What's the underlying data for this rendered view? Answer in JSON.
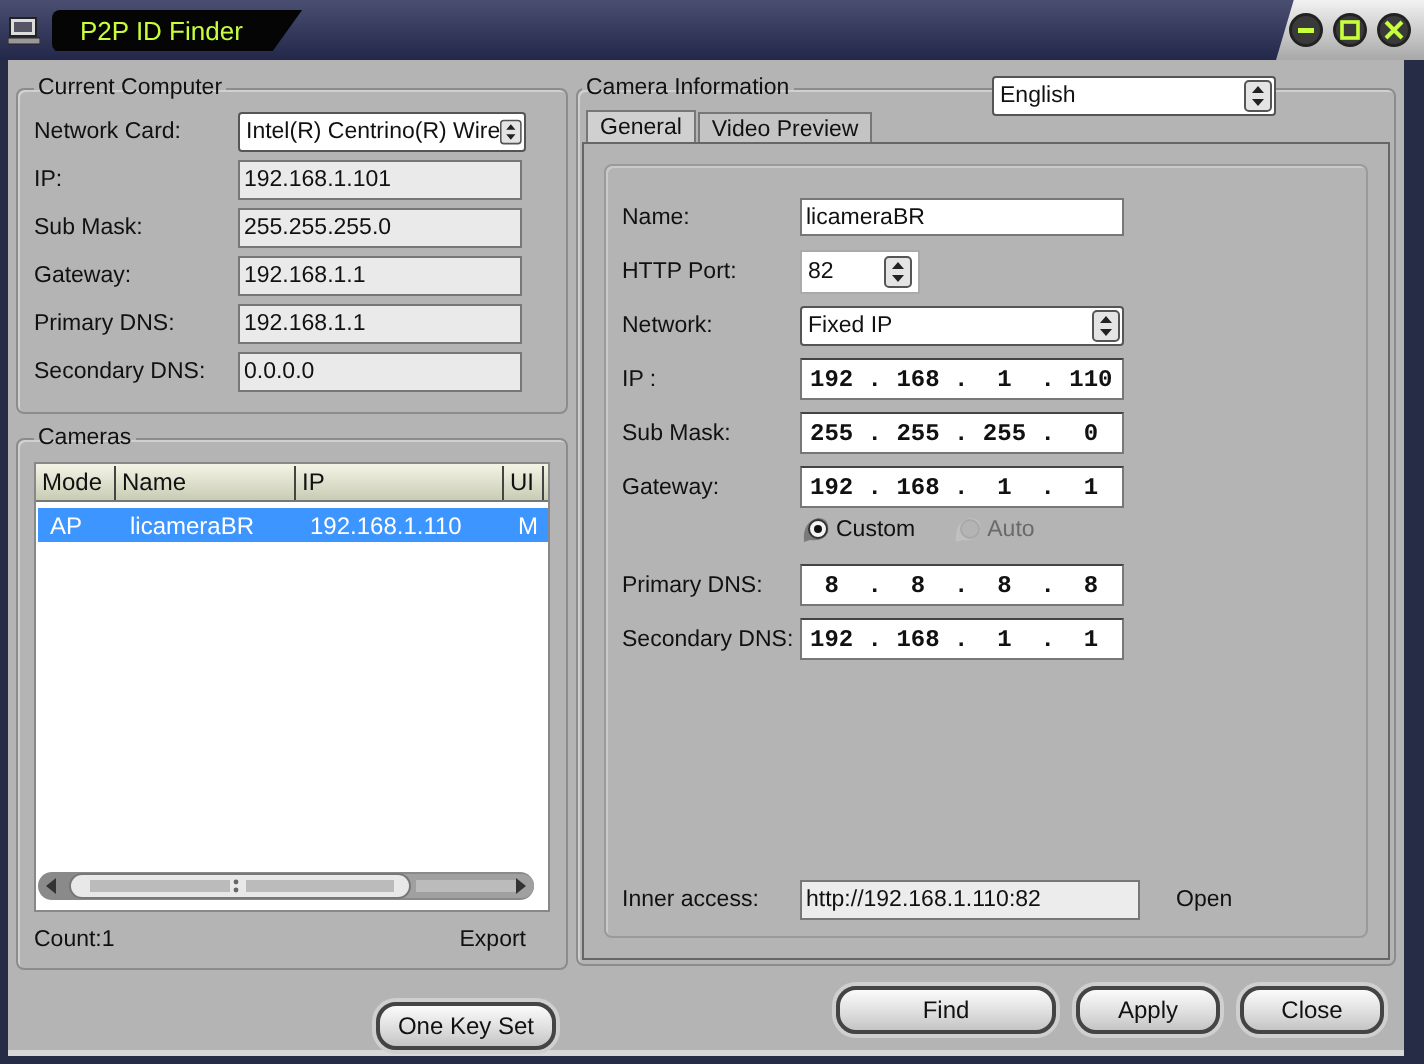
{
  "window": {
    "title": "P2P ID Finder"
  },
  "current_computer": {
    "title": "Current Computer",
    "fields": [
      {
        "kind": "select",
        "label": "Network Card:",
        "value": "Intel(R) Centrino(R) Wire"
      },
      {
        "kind": "readonly",
        "label": "IP:",
        "value": "192.168.1.101"
      },
      {
        "kind": "readonly",
        "label": "Sub Mask:",
        "value": "255.255.255.0"
      },
      {
        "kind": "readonly",
        "label": "Gateway:",
        "value": "192.168.1.1"
      },
      {
        "kind": "readonly",
        "label": "Primary DNS:",
        "value": "192.168.1.1"
      },
      {
        "kind": "readonly",
        "label": "Secondary DNS:",
        "value": "0.0.0.0"
      }
    ]
  },
  "cameras": {
    "title": "Cameras",
    "columns": [
      "Mode",
      "Name",
      "IP",
      "UI"
    ],
    "rows": [
      {
        "cells": [
          "AP",
          "licameraBR",
          "192.168.1.110",
          "M"
        ],
        "selected": true
      }
    ],
    "count": "Count:1",
    "export": "Export"
  },
  "one_key_set": "One Key Set",
  "camera_info": {
    "title": "Camera Information",
    "language": "English",
    "tabs": [
      {
        "label": "General",
        "selected": true
      },
      {
        "label": "Video Preview",
        "selected": false
      }
    ],
    "fields": [
      {
        "kind": "text",
        "label": "Name:",
        "value": "licameraBR"
      },
      {
        "kind": "spin",
        "label": "HTTP Port:",
        "value": "82"
      },
      {
        "kind": "select",
        "label": "Network:",
        "value": "Fixed IP"
      },
      {
        "kind": "ip",
        "label": "IP  :",
        "value": "192 . 168 .  1  . 110"
      },
      {
        "kind": "ip",
        "label": "Sub Mask:",
        "value": "255 . 255 . 255 .  0"
      },
      {
        "kind": "ip",
        "label": "Gateway:",
        "value": "192 . 168 .  1  .  1"
      },
      {
        "kind": "radios",
        "options": [
          {
            "label": "Custom",
            "selected": true,
            "disabled": false
          },
          {
            "label": "Auto",
            "selected": false,
            "disabled": true
          }
        ]
      },
      {
        "kind": "ip",
        "label": "Primary DNS:",
        "value": " 8  .  8  .  8  .  8"
      },
      {
        "kind": "ip",
        "label": "Secondary DNS:",
        "value": "192 . 168 .  1  .  1"
      }
    ],
    "inner_access": {
      "label": "Inner access:",
      "value": "http://192.168.1.110:82",
      "link": "Open"
    }
  },
  "buttons": [
    "Find",
    "Apply",
    "Close"
  ]
}
